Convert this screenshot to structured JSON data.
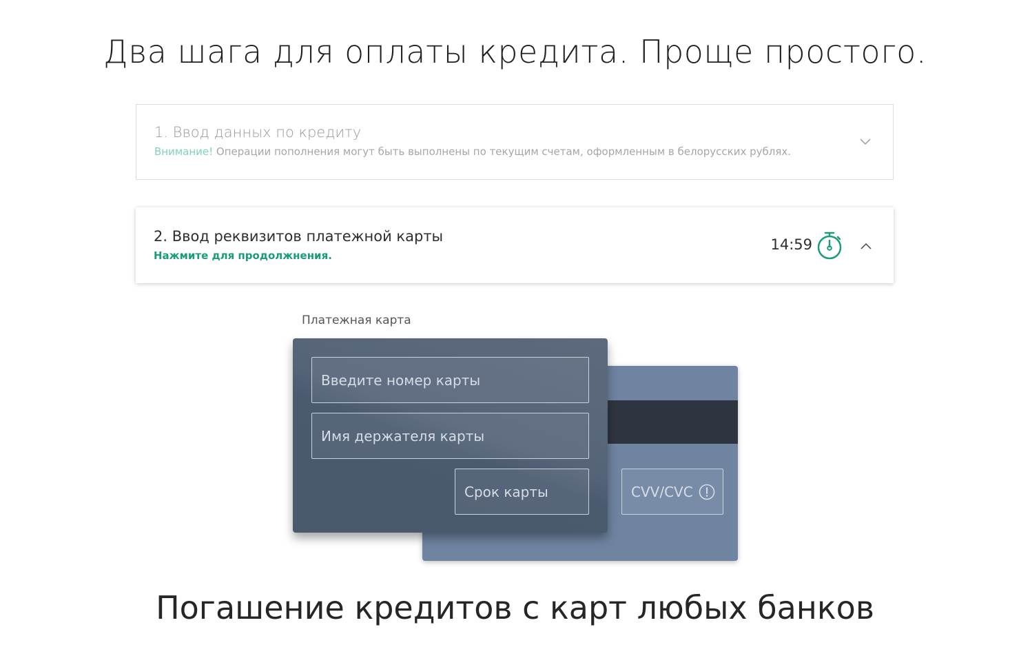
{
  "headline": "Два шага для оплаты кредита. Проще простого.",
  "step1": {
    "title": "1. Ввод данных по кредиту",
    "note_warning": "Внимание!",
    "note_text": " Операции пополнения могут быть выполнены по текущим счетам, оформленным в белорусских рублях.",
    "chevron_icon": "chevron-down-icon"
  },
  "step2": {
    "title": "2. Ввод реквизитов платежной карты",
    "hint": "Нажмите для продолжнения.",
    "timer": "14:59",
    "timer_icon": "stopwatch-icon",
    "chevron_icon": "chevron-up-icon"
  },
  "card": {
    "label": "Платежная карта",
    "number_placeholder": "Введите номер карты",
    "holder_placeholder": "Имя держателя карты",
    "expiry_placeholder": "Срок карты",
    "cvv_placeholder": "CVV/CVC",
    "cvv_info_icon": "info-icon"
  },
  "tagline": "Погашение кредитов с карт любых банков",
  "colors": {
    "accent": "#1a9c7a",
    "warning_light": "#7fd3bb",
    "card_front": "#56647a",
    "card_back": "#6f84a1",
    "mag_stripe": "#2f3540"
  }
}
